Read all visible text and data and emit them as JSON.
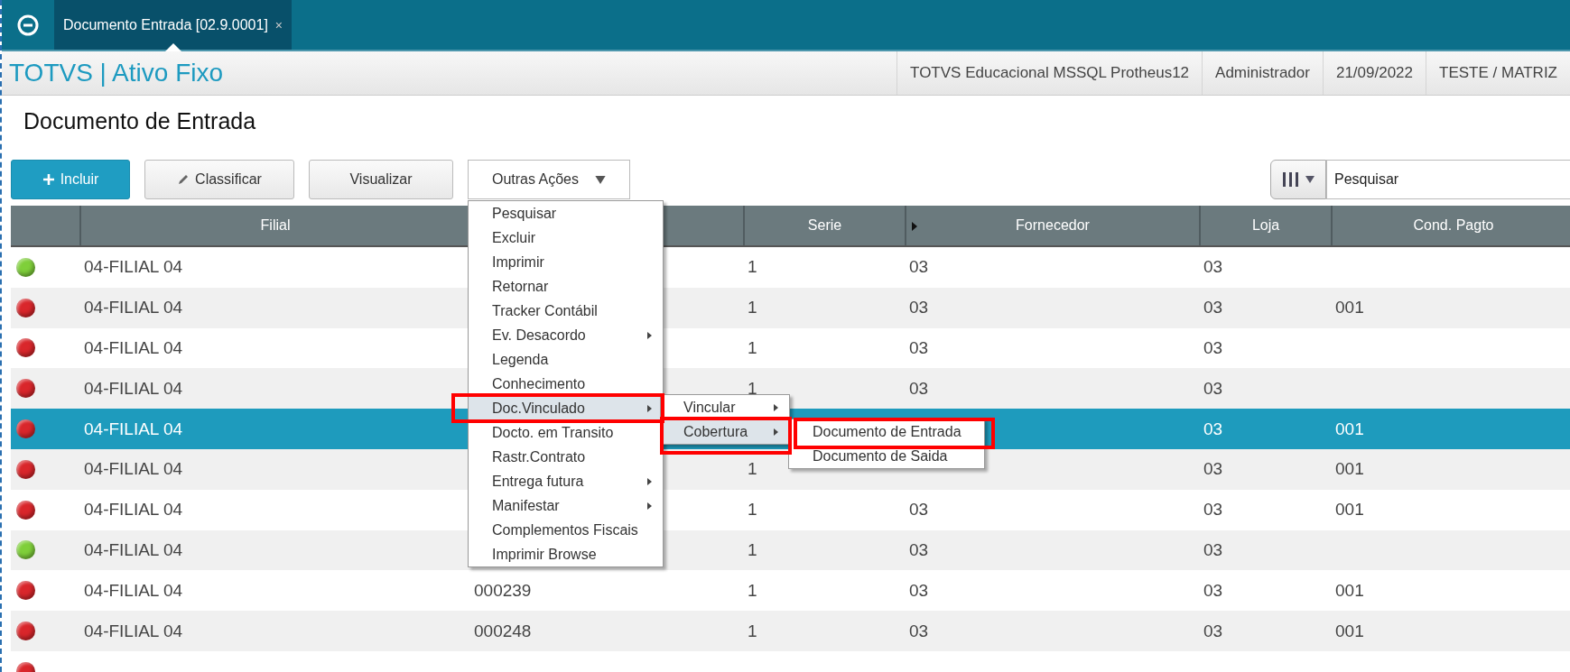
{
  "app_tab": {
    "title": "Documento Entrada [02.9.0001]",
    "close": "×",
    "selected": true
  },
  "header": {
    "app_title": "TOTVS | Ativo Fixo",
    "info": [
      "TOTVS Educacional MSSQL Protheus12",
      "Administrador",
      "21/09/2022",
      "TESTE / MATRIZ"
    ]
  },
  "page_title": "Documento de Entrada",
  "toolbar": {
    "buttons": [
      {
        "kind": "primary",
        "label": "Incluir"
      },
      {
        "kind": "edit",
        "label": "Classificar"
      },
      {
        "kind": "plain",
        "label": "Visualizar"
      },
      {
        "kind": "dropdown",
        "label": "Outras Ações"
      }
    ],
    "search": {
      "placeholder": "Pesquisar"
    }
  },
  "table": {
    "columns": [
      "",
      "Filial",
      "",
      "Serie",
      "Fornecedor",
      "Loja",
      "Cond. Pagto"
    ],
    "rows": [
      {
        "color": "#7fcf3a",
        "selected": false,
        "filial": "04-FILIAL 04",
        "serie": "1",
        "fornecedor": "03",
        "loja": "03"
      },
      {
        "color": "#d9262b",
        "selected": false,
        "filial": "04-FILIAL 04",
        "serie": "1",
        "fornecedor": "03",
        "loja": "03",
        "cond": "001"
      },
      {
        "color": "#d9262b",
        "selected": false,
        "filial": "04-FILIAL 04",
        "serie": "1",
        "fornecedor": "03",
        "loja": "03"
      },
      {
        "color": "#d9262b",
        "selected": false,
        "filial": "04-FILIAL 04",
        "serie": "1",
        "fornecedor": "03",
        "loja": "03"
      },
      {
        "color": "#d9262b",
        "selected": true,
        "filial": "04-FILIAL 04",
        "loja": "03",
        "cond": "001"
      },
      {
        "color": "#d9262b",
        "selected": false,
        "filial": "04-FILIAL 04",
        "serie": "1",
        "loja": "03",
        "cond": "001"
      },
      {
        "color": "#d9262b",
        "selected": false,
        "filial": "04-FILIAL 04",
        "serie": "1",
        "fornecedor": "03",
        "loja": "03",
        "cond": "001"
      },
      {
        "color": "#7fcf3a",
        "selected": false,
        "filial": "04-FILIAL 04",
        "serie": "1",
        "fornecedor": "03",
        "loja": "03"
      },
      {
        "color": "#d9262b",
        "selected": false,
        "filial": "04-FILIAL 04",
        "doc": "000239",
        "serie": "1",
        "fornecedor": "03",
        "loja": "03",
        "cond": "001"
      },
      {
        "color": "#d9262b",
        "selected": false,
        "filial": "04-FILIAL 04",
        "doc": "000248",
        "serie": "1",
        "fornecedor": "03",
        "loja": "03",
        "cond": "001"
      },
      {
        "color": "#d9262b",
        "selected": false
      }
    ]
  },
  "menu": [
    {
      "label": "Pesquisar",
      "submenu": false,
      "selected": false,
      "marked": false
    },
    {
      "label": "Excluir",
      "submenu": false,
      "selected": false,
      "marked": false
    },
    {
      "label": "Imprimir",
      "submenu": false,
      "selected": false,
      "marked": false
    },
    {
      "label": "Retornar",
      "submenu": false,
      "selected": false,
      "marked": false
    },
    {
      "label": "Tracker Contábil",
      "submenu": false,
      "selected": false,
      "marked": false
    },
    {
      "label": "Ev. Desacordo",
      "submenu": true,
      "selected": false,
      "marked": false
    },
    {
      "label": "Legenda",
      "submenu": false,
      "selected": false,
      "marked": false
    },
    {
      "label": "Conhecimento",
      "submenu": false,
      "selected": false,
      "marked": false
    },
    {
      "label": "Doc.Vinculado",
      "submenu": true,
      "selected": true,
      "marked": true
    },
    {
      "label": "Docto. em Transito",
      "submenu": false,
      "selected": false,
      "marked": false
    },
    {
      "label": "Rastr.Contrato",
      "submenu": false,
      "selected": false,
      "marked": false
    },
    {
      "label": "Entrega futura",
      "submenu": true,
      "selected": false,
      "marked": false
    },
    {
      "label": "Manifestar",
      "submenu": true,
      "selected": false,
      "marked": false
    },
    {
      "label": "Complementos Fiscais",
      "submenu": false,
      "selected": false,
      "marked": false
    },
    {
      "label": "Imprimir Browse",
      "submenu": false,
      "selected": false,
      "marked": false
    }
  ],
  "submenu": [
    {
      "label": "Vincular",
      "submenu": true,
      "selected": false,
      "marked": false
    },
    {
      "label": "Cobertura",
      "submenu": true,
      "selected": true,
      "marked": true
    }
  ],
  "submenu_2": [
    {
      "label": "Documento de Entrada",
      "submenu": false,
      "selected": false,
      "marked": true
    },
    {
      "label": "Documento de Saida",
      "submenu": false,
      "selected": false,
      "marked": false
    }
  ]
}
